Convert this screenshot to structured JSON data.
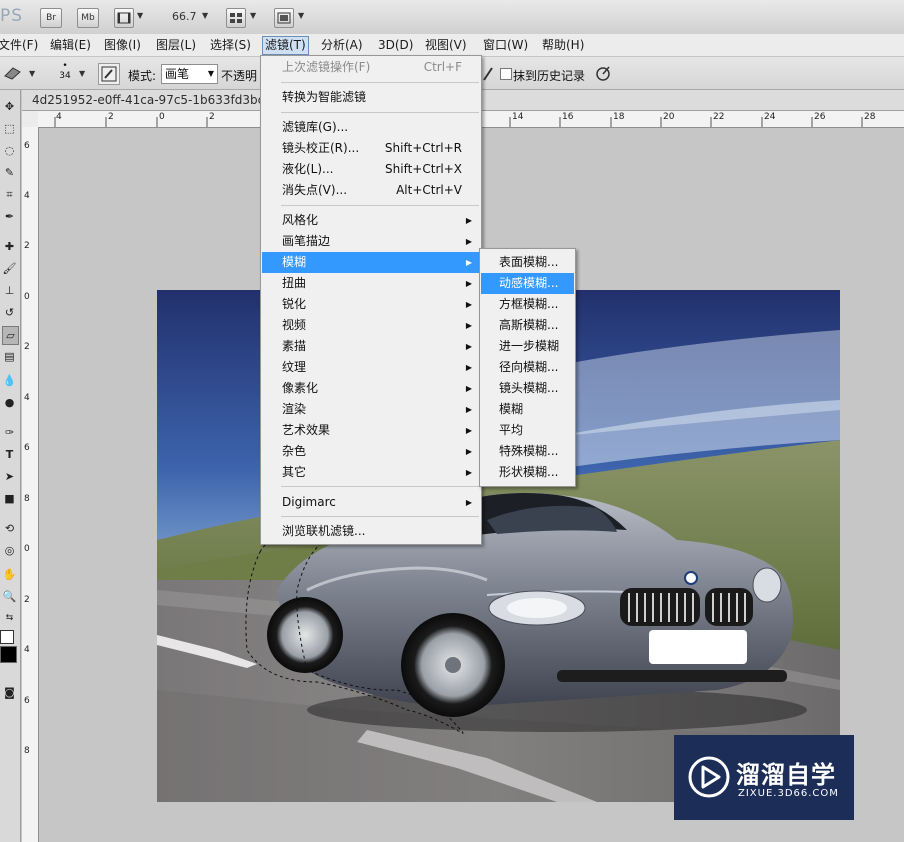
{
  "appbar": {
    "logo": "PS",
    "br_label": "Br",
    "mb_label": "Mb",
    "zoom_value": "66.7"
  },
  "menubar": {
    "items": [
      "文件(F)",
      "编辑(E)",
      "图像(I)",
      "图层(L)",
      "选择(S)",
      "滤镜(T)",
      "分析(A)",
      "3D(D)",
      "视图(V)",
      "窗口(W)",
      "帮助(H)"
    ],
    "active": "滤镜(T)"
  },
  "options": {
    "brush_size": "34",
    "mode_label": "模式:",
    "mode_value": "画笔",
    "opacity_label": "不透明",
    "erase_history_label": "抹到历史记录"
  },
  "document": {
    "tab_title": "4d251952-e0ff-41ca-97c5-1b633fd3bcf3",
    "hruler_ticks": [
      "4",
      "2",
      "0",
      "2",
      "14",
      "16",
      "18",
      "20",
      "22",
      "24",
      "26",
      "28"
    ],
    "vruler_ticks": [
      "6",
      "4",
      "2",
      "0",
      "2",
      "4",
      "6",
      "8",
      "0",
      "2",
      "4",
      "6",
      "8"
    ]
  },
  "filter_menu": {
    "items": [
      {
        "label": "上次滤镜操作(F)",
        "shortcut": "Ctrl+F",
        "disabled": true
      },
      {
        "label": "转换为智能滤镜"
      },
      {
        "label": "滤镜库(G)..."
      },
      {
        "label": "镜头校正(R)...",
        "shortcut": "Shift+Ctrl+R"
      },
      {
        "label": "液化(L)...",
        "shortcut": "Shift+Ctrl+X"
      },
      {
        "label": "消失点(V)...",
        "shortcut": "Alt+Ctrl+V"
      },
      {
        "label": "风格化",
        "submenu": true
      },
      {
        "label": "画笔描边",
        "submenu": true
      },
      {
        "label": "模糊",
        "submenu": true,
        "highlighted": true
      },
      {
        "label": "扭曲",
        "submenu": true
      },
      {
        "label": "锐化",
        "submenu": true
      },
      {
        "label": "视频",
        "submenu": true
      },
      {
        "label": "素描",
        "submenu": true
      },
      {
        "label": "纹理",
        "submenu": true
      },
      {
        "label": "像素化",
        "submenu": true
      },
      {
        "label": "渲染",
        "submenu": true
      },
      {
        "label": "艺术效果",
        "submenu": true
      },
      {
        "label": "杂色",
        "submenu": true
      },
      {
        "label": "其它",
        "submenu": true
      },
      {
        "label": "Digimarc",
        "submenu": true
      },
      {
        "label": "浏览联机滤镜..."
      }
    ]
  },
  "blur_submenu": {
    "items": [
      "表面模糊...",
      "动感模糊...",
      "方框模糊...",
      "高斯模糊...",
      "进一步模糊",
      "径向模糊...",
      "镜头模糊...",
      "模糊",
      "平均",
      "特殊模糊...",
      "形状模糊..."
    ],
    "highlighted": "动感模糊..."
  },
  "watermark": {
    "name": "溜溜自学",
    "url": "ZIXUE.3D66.COM"
  },
  "colors": {
    "menu_highlight": "#3399ff",
    "watermark_bg": "#1c2e57"
  }
}
